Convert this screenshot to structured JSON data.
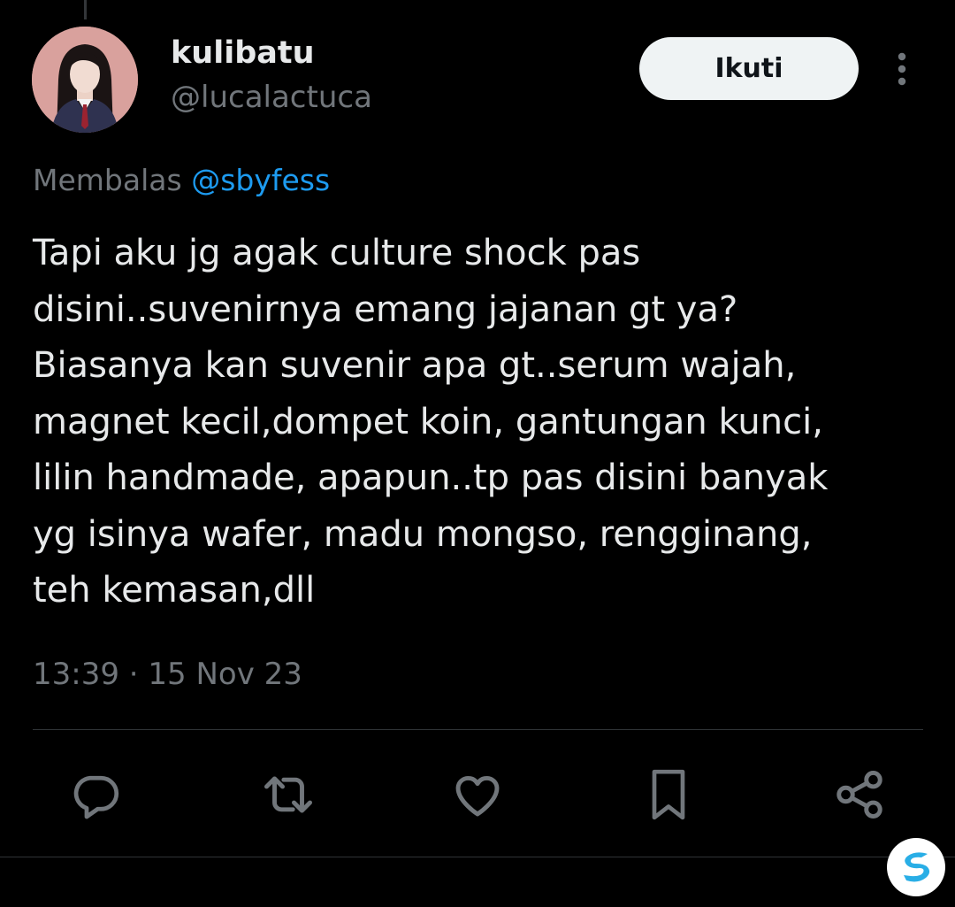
{
  "tweet": {
    "display_name": "kulibatu",
    "handle": "@lucalactuca",
    "follow_label": "Ikuti",
    "reply_prefix": "Membalas",
    "reply_mention": "@sbyfess",
    "lines": [
      "Tapi aku jg agak culture shock pas",
      "disini..suvenirnya emang jajanan gt ya?",
      "Biasanya kan suvenir apa gt..serum wajah,",
      "magnet kecil,dompet koin, gantungan kunci,",
      "lilin handmade, apapun..tp pas disini banyak",
      "yg isinya wafer, madu mongso, rengginang,",
      "teh kemasan,dll"
    ],
    "timestamp": "13:39 · 15 Nov 23"
  },
  "icons": {
    "more": "more-vertical-icon",
    "reply": "reply-icon",
    "retweet": "retweet-icon",
    "like": "heart-icon",
    "bookmark": "bookmark-icon",
    "share": "share-icon",
    "watermark": "watermark-logo-icon"
  },
  "colors": {
    "background": "#000000",
    "text_primary": "#e7e9ea",
    "text_secondary": "#71767b",
    "mention": "#1d9bf0",
    "follow_button_bg": "#eff3f4",
    "follow_button_text": "#0f1419",
    "divider": "#2f3336",
    "icon": "#71767b"
  }
}
